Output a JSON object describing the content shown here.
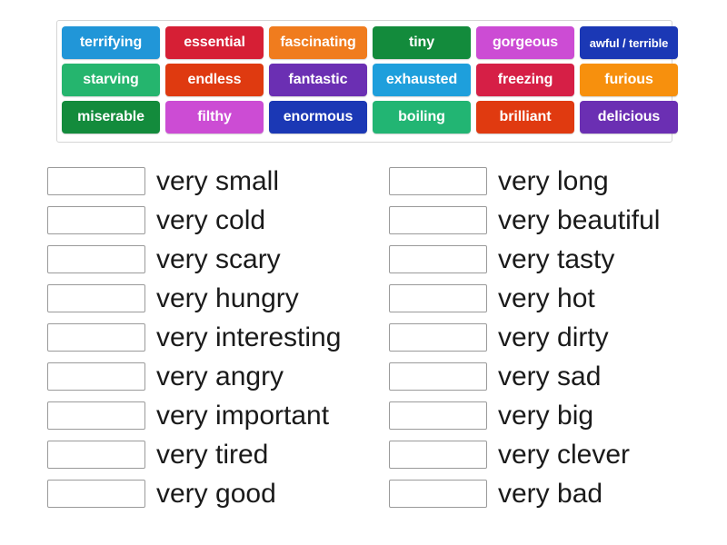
{
  "word_bank": {
    "rows": [
      [
        {
          "label": "terrifying",
          "color": "#2196d8"
        },
        {
          "label": "essential",
          "color": "#d61f35"
        },
        {
          "label": "fascinating",
          "color": "#f07c1e"
        },
        {
          "label": "tiny",
          "color": "#138b3c"
        },
        {
          "label": "gorgeous",
          "color": "#cc4cd4"
        },
        {
          "label": "awful / terrible",
          "color": "#1b38b5",
          "small": true
        }
      ],
      [
        {
          "label": "starving",
          "color": "#25b56e"
        },
        {
          "label": "endless",
          "color": "#df3a10"
        },
        {
          "label": "fantastic",
          "color": "#6b2fb3"
        },
        {
          "label": "exhausted",
          "color": "#1e9fdc"
        },
        {
          "label": "freezing",
          "color": "#d61f46"
        },
        {
          "label": "furious",
          "color": "#f7900d"
        }
      ],
      [
        {
          "label": "miserable",
          "color": "#138b3c"
        },
        {
          "label": "filthy",
          "color": "#cc4cd4"
        },
        {
          "label": "enormous",
          "color": "#1b38b5"
        },
        {
          "label": "boiling",
          "color": "#22b573"
        },
        {
          "label": "brilliant",
          "color": "#e03a10"
        },
        {
          "label": "delicious",
          "color": "#6b2fb3"
        }
      ]
    ]
  },
  "answers": {
    "left_column": [
      {
        "definition": "very small"
      },
      {
        "definition": "very cold"
      },
      {
        "definition": "very scary"
      },
      {
        "definition": "very hungry"
      },
      {
        "definition": "very interesting"
      },
      {
        "definition": "very angry"
      },
      {
        "definition": "very important"
      },
      {
        "definition": "very tired"
      },
      {
        "definition": "very good"
      }
    ],
    "right_column": [
      {
        "definition": "very long"
      },
      {
        "definition": "very beautiful"
      },
      {
        "definition": "very tasty"
      },
      {
        "definition": "very hot"
      },
      {
        "definition": "very dirty"
      },
      {
        "definition": "very sad"
      },
      {
        "definition": "very big"
      },
      {
        "definition": "very clever"
      },
      {
        "definition": "very bad"
      }
    ]
  }
}
